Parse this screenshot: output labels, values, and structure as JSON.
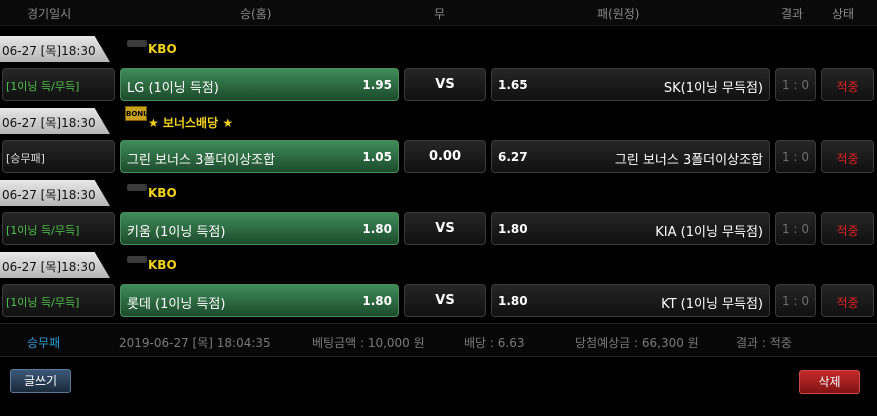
{
  "header": {
    "datetime": "경기일시",
    "home": "승(홈)",
    "draw": "무",
    "away": "패(원정)",
    "result": "결과",
    "status": "상태"
  },
  "bets": [
    {
      "date": "06-27 [목]18:30",
      "league": "KBO",
      "type": "[1이닝 득/무득]",
      "home_team": "LG (1이닝 득점)",
      "home_odd": "1.95",
      "draw": "VS",
      "away_odd": "1.65",
      "away_team": "SK(1이닝 무득점)",
      "score": "1 : 0",
      "status": "적중"
    },
    {
      "date": "06-27 [목]18:30",
      "league": "★ 보너스배당 ★",
      "badge": "BONUS",
      "type": "[승무패]",
      "home_team": "그린 보너스 3폴더이상조합",
      "home_odd": "1.05",
      "draw": "0.00",
      "away_odd": "6.27",
      "away_team": "그린 보너스 3폴더이상조합",
      "score": "1 : 0",
      "status": "적중"
    },
    {
      "date": "06-27 [목]18:30",
      "league": "KBO",
      "type": "[1이닝 득/무득]",
      "home_team": "키움 (1이닝 득점)",
      "home_odd": "1.80",
      "draw": "VS",
      "away_odd": "1.80",
      "away_team": "KIA (1이닝 무득점)",
      "score": "1 : 0",
      "status": "적중"
    },
    {
      "date": "06-27 [목]18:30",
      "league": "KBO",
      "type": "[1이닝 득/무득]",
      "home_team": "롯데 (1이닝 득점)",
      "home_odd": "1.80",
      "draw": "VS",
      "away_odd": "1.80",
      "away_team": "KT (1이닝 무득점)",
      "score": "1 : 0",
      "status": "적중"
    }
  ],
  "summary": {
    "type": "승무패",
    "datetime": "2019-06-27 [목] 18:04:35",
    "bet_amount": "베팅금액 : 10,000 원",
    "odds": "배당 : 6.63",
    "expected_win": "당첨예상금 : 66,300 원",
    "result": "결과 : 적중"
  },
  "buttons": {
    "write": "글쓰기",
    "delete": "삭제"
  },
  "colors": {
    "win_status": "#e02020",
    "home_bg": "#2d6b43",
    "league": "#f2d21b",
    "type_green": "#4cc24c",
    "summary_type": "#2e9bd6"
  }
}
